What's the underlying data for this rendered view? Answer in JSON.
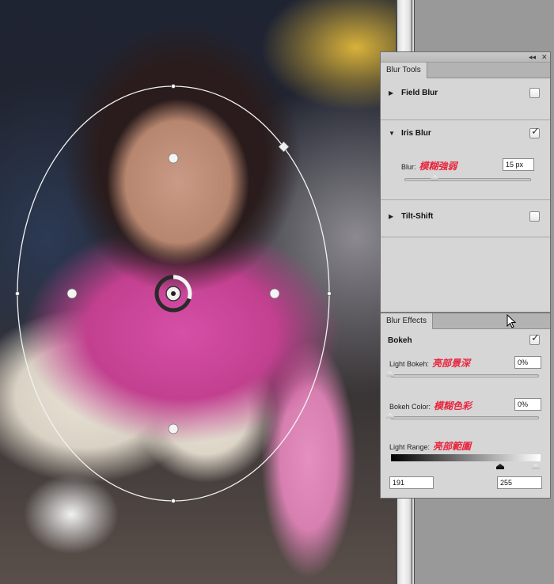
{
  "canvas": {
    "description": "photo of child holding a stuffed toy with iris blur overlay"
  },
  "iris_overlay": {
    "center_pin": "iris-center-pin",
    "handles": [
      "top-handle",
      "right-handle",
      "bottom-handle",
      "left-handle",
      "feather-handle-top",
      "feather-handle-right",
      "feather-handle-bottom",
      "feather-handle-left",
      "roundness-knob"
    ],
    "blur_ring_fraction": 0.3
  },
  "panel": {
    "topbar": {
      "collapse_icon": "◂◂",
      "close_icon": "✕"
    },
    "blur_tools": {
      "tab_label": "Blur Tools",
      "sections": [
        {
          "title": "Field Blur",
          "expanded": false,
          "checked": false
        },
        {
          "title": "Iris Blur",
          "expanded": true,
          "checked": true
        },
        {
          "title": "Tilt-Shift",
          "expanded": false,
          "checked": false
        }
      ],
      "iris": {
        "blur_label": "Blur:",
        "blur_annotation": "模糊強弱",
        "blur_value": "15 px",
        "blur_slider_fraction": 0.24
      }
    },
    "blur_effects": {
      "tab_label": "Blur Effects",
      "bokeh_title": "Bokeh",
      "bokeh_checked": true,
      "light_bokeh_label": "Light Bokeh:",
      "light_bokeh_annotation": "亮部景深",
      "light_bokeh_value": "0%",
      "light_bokeh_fraction": 0,
      "bokeh_color_label": "Bokeh Color:",
      "bokeh_color_annotation": "模糊色彩",
      "bokeh_color_value": "0%",
      "bokeh_color_fraction": 0,
      "light_range_label": "Light Range:",
      "light_range_annotation": "亮部範圍",
      "light_range_low": "191",
      "light_range_high": "255"
    }
  }
}
